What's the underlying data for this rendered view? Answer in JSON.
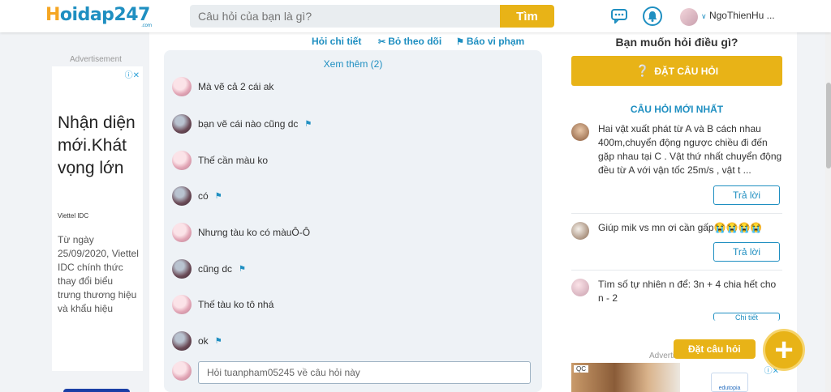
{
  "header": {
    "logo_part1": "H",
    "logo_part2": "oidap247",
    "logo_suffix": ".com",
    "search_placeholder": "Câu hỏi của bạn là gì?",
    "search_button": "Tìm",
    "username": "NgoThienHu ..."
  },
  "left_ad": {
    "label": "Advertisement",
    "close": "ⓘ✕",
    "headline": "Nhận diện mới.Khát vọng lớn",
    "brand": "Viettel IDC",
    "body": "Từ ngày 25/09/2020, Viettel IDC chính thức thay đổi biểu trưng thương hiệu và khẩu hiệu"
  },
  "question_actions": {
    "detail": "Hỏi chi tiết",
    "unfollow": "Bỏ theo dõi",
    "report": "Báo vi phạm"
  },
  "comments": {
    "see_more": "Xem thêm (2)",
    "items": [
      {
        "text": "Mà vẽ cả 2 cái ak",
        "avatar": "pink"
      },
      {
        "text": "bạn vẽ cái nào cũng dc",
        "avatar": "dark"
      },
      {
        "text": "Thế cần màu ko",
        "avatar": "pink"
      },
      {
        "text": "có",
        "avatar": "dark"
      },
      {
        "text": "Nhưng tàu ko có màuÔ-Ô",
        "avatar": "pink"
      },
      {
        "text": "cũng dc",
        "avatar": "dark"
      },
      {
        "text": "Thế tàu ko tô nhá",
        "avatar": "pink"
      },
      {
        "text": "ok",
        "avatar": "dark"
      }
    ],
    "reply_placeholder": "Hỏi tuanpham05245 về câu hỏi này"
  },
  "sidebar": {
    "ask_title": "Bạn muốn hỏi điều gì?",
    "ask_button": "ĐẶT CÂU HỎI",
    "newest_title": "CÂU HỎI MỚI NHẤT",
    "questions": [
      {
        "text": "Hai vật xuất phát từ A và B cách nhau 400m,chuyển động ngược chiều đi đến gặp nhau tại C . Vật thứ nhất chuyển động đều từ A với vận tốc 25m/s , vật t ...",
        "reply": "Trả lời"
      },
      {
        "text": "Giúp mik vs mn ơi cần gấp😭😭😭😭",
        "reply": "Trả lời"
      },
      {
        "text": "Tìm số tự nhiên n để: 3n + 4 chia hết cho n - 2",
        "reply": "Chi tiết"
      }
    ],
    "ad_label": "Advertisement",
    "ad_tag": "QC",
    "ad_logo": "edutopia",
    "ad_close": "ⓘ✕"
  },
  "floating": {
    "label": "Đặt câu hỏi",
    "plus": "+"
  },
  "colors": {
    "accent_yellow": "#e8b317",
    "brand_blue": "#1f8fc1",
    "logo_orange": "#f5a623"
  }
}
